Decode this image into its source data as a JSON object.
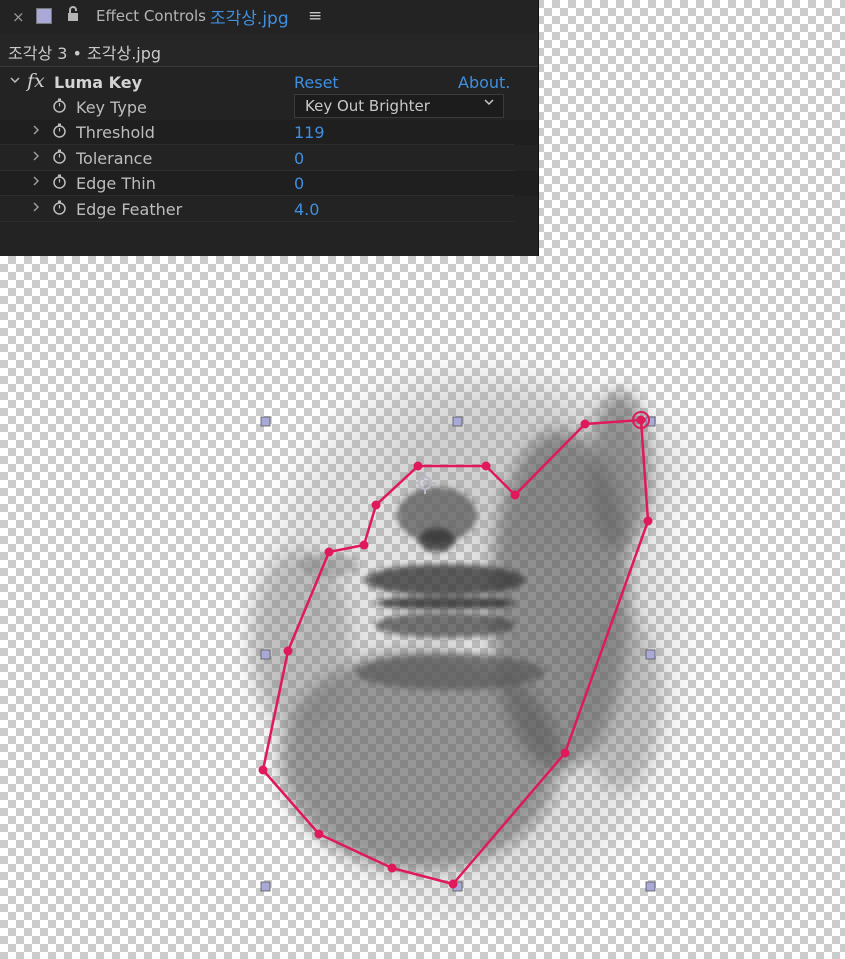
{
  "panel": {
    "tab": {
      "close": "×",
      "label": "Effect Controls",
      "file": "조각상.jpg",
      "menu": "≡"
    },
    "layer_line": "조각상 3 • 조각상.jpg",
    "effect": {
      "name": "Luma Key",
      "fx": "fx",
      "reset": "Reset",
      "about": "About."
    },
    "params": [
      {
        "name": "Key Type",
        "value": "Key Out Brighter",
        "type": "dropdown"
      },
      {
        "name": "Threshold",
        "value": "119"
      },
      {
        "name": "Tolerance",
        "value": "0"
      },
      {
        "name": "Edge Thin",
        "value": "0"
      },
      {
        "name": "Edge Feather",
        "value": "4.0"
      }
    ]
  },
  "icons": {
    "close": "close-icon",
    "swatch": "color-label-icon",
    "lock": "lock-icon",
    "menu": "panel-menu-icon",
    "stopwatch": "stopwatch-icon",
    "twirl": "chevron-right-icon",
    "dropdown": "chevron-down-icon",
    "anchor": "anchor-point-icon"
  },
  "colors": {
    "panel_bg": "#232323",
    "value_blue": "#3f8fe0",
    "mask_path": "#e0195a",
    "handle": "#a9a9d8"
  }
}
